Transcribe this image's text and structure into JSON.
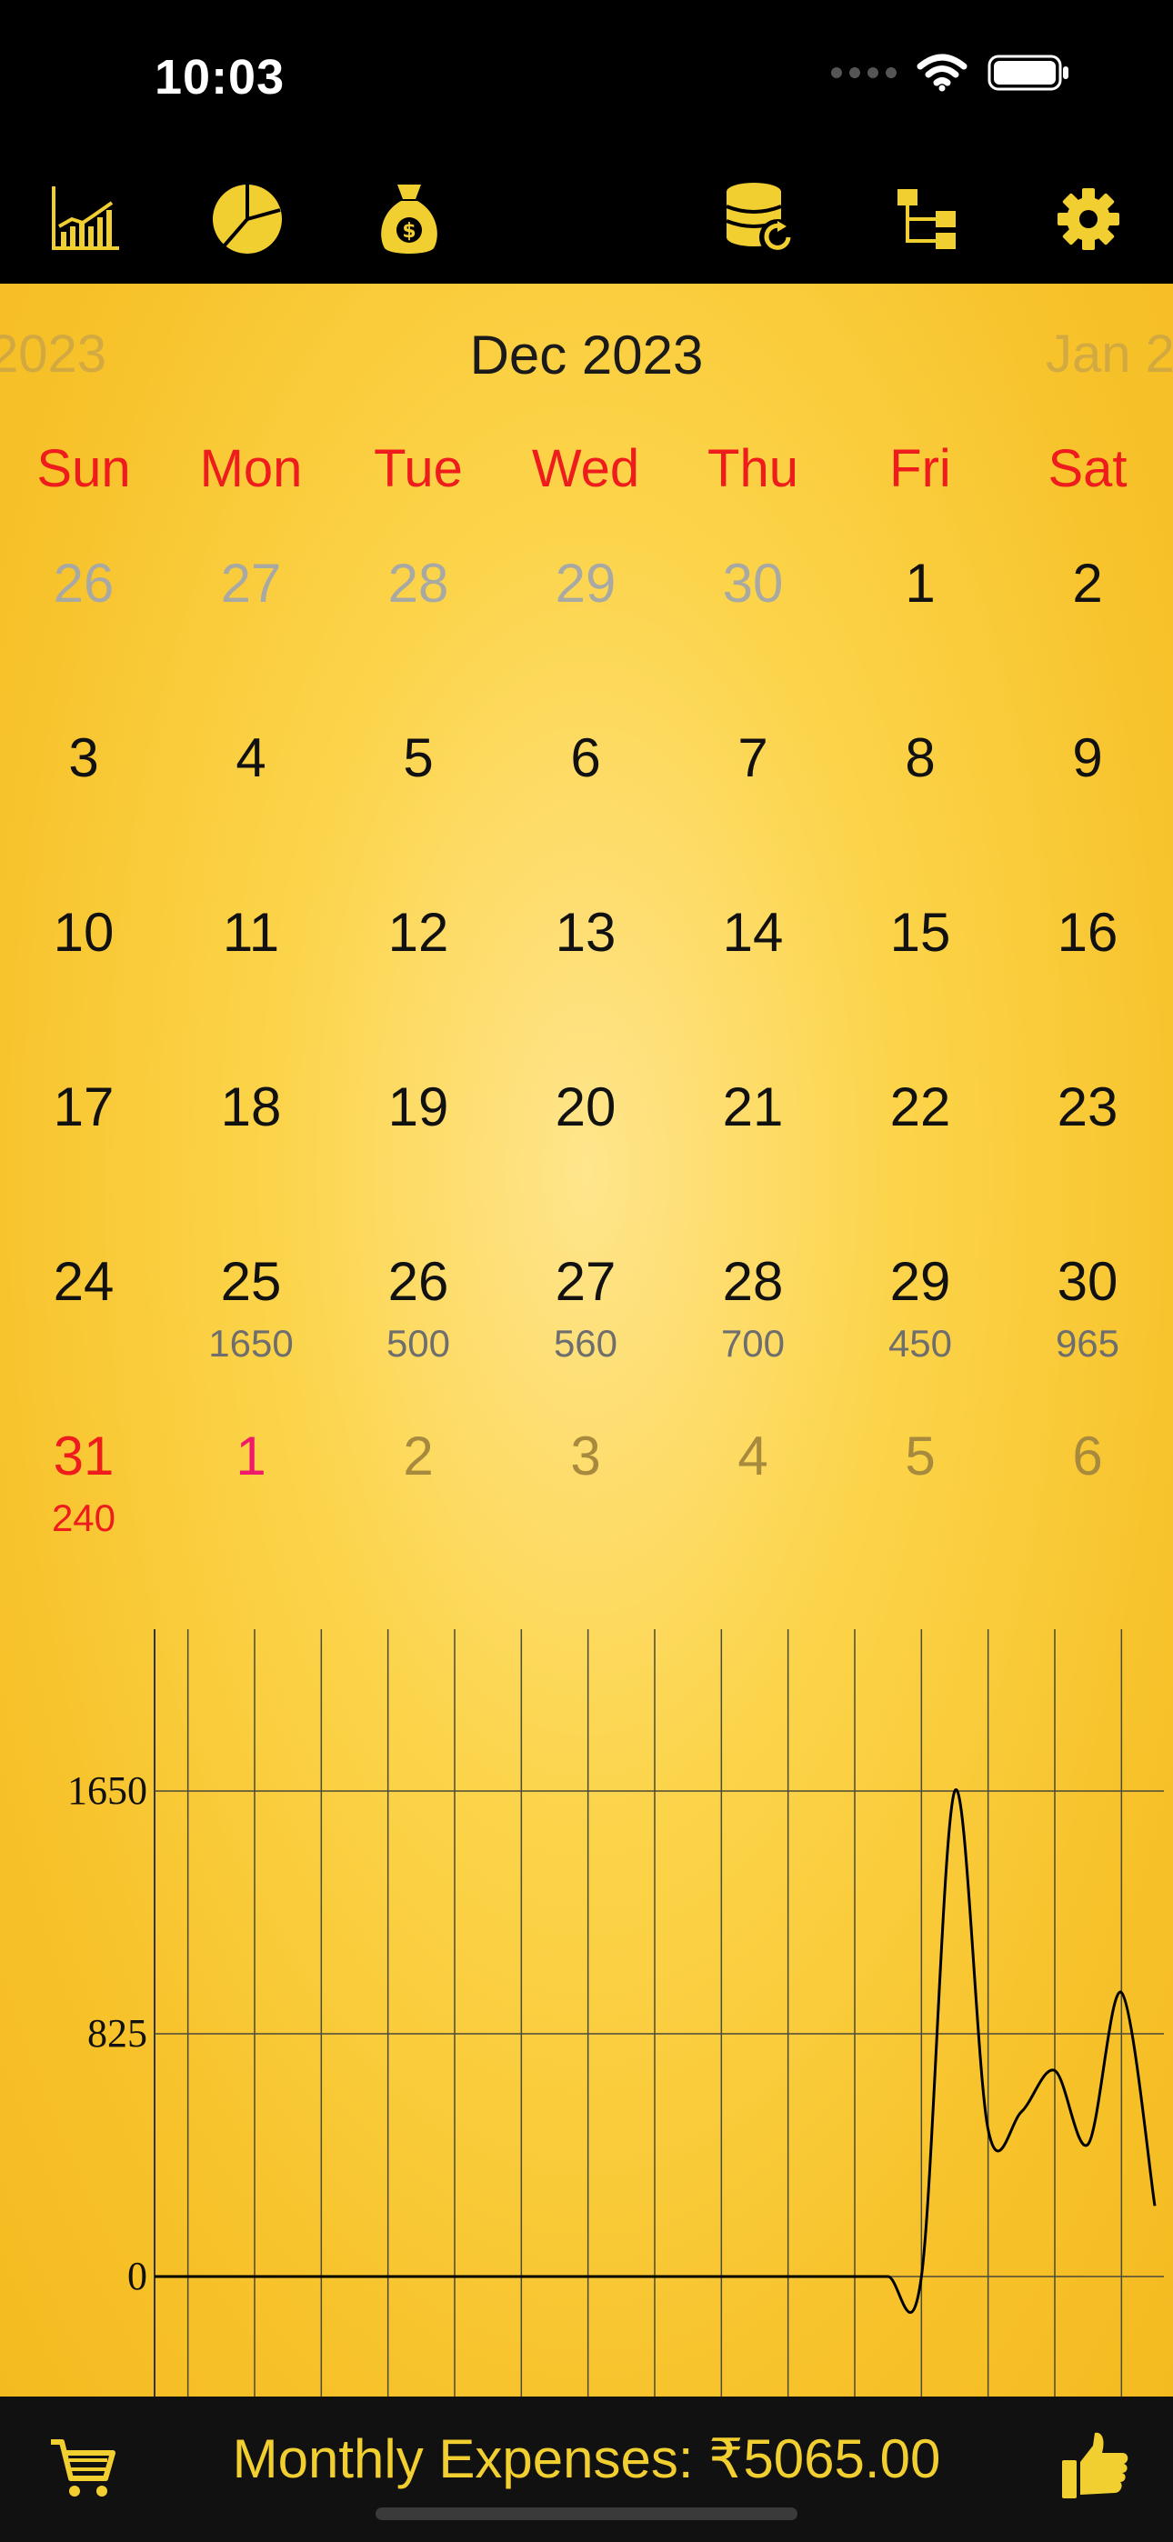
{
  "status_bar": {
    "time": "10:03"
  },
  "toolbar": {
    "items": [
      {
        "icon": "bar-chart-icon"
      },
      {
        "icon": "pie-chart-icon"
      },
      {
        "icon": "money-bag-icon"
      },
      {
        "icon": "coins-refresh-icon"
      },
      {
        "icon": "category-tree-icon"
      },
      {
        "icon": "gear-icon"
      }
    ]
  },
  "month_nav": {
    "prev": "2023",
    "current": "Dec 2023",
    "next": "Jan 2"
  },
  "weekdays": [
    "Sun",
    "Mon",
    "Tue",
    "Wed",
    "Thu",
    "Fri",
    "Sat"
  ],
  "weeks": [
    [
      {
        "day": "26",
        "state": "muted"
      },
      {
        "day": "27",
        "state": "muted"
      },
      {
        "day": "28",
        "state": "muted"
      },
      {
        "day": "29",
        "state": "muted"
      },
      {
        "day": "30",
        "state": "muted"
      },
      {
        "day": "1"
      },
      {
        "day": "2"
      }
    ],
    [
      {
        "day": "3"
      },
      {
        "day": "4"
      },
      {
        "day": "5"
      },
      {
        "day": "6"
      },
      {
        "day": "7"
      },
      {
        "day": "8"
      },
      {
        "day": "9"
      }
    ],
    [
      {
        "day": "10"
      },
      {
        "day": "11"
      },
      {
        "day": "12"
      },
      {
        "day": "13"
      },
      {
        "day": "14"
      },
      {
        "day": "15"
      },
      {
        "day": "16"
      }
    ],
    [
      {
        "day": "17"
      },
      {
        "day": "18"
      },
      {
        "day": "19"
      },
      {
        "day": "20"
      },
      {
        "day": "21"
      },
      {
        "day": "22"
      },
      {
        "day": "23"
      }
    ],
    [
      {
        "day": "24"
      },
      {
        "day": "25",
        "amount": "1650"
      },
      {
        "day": "26",
        "amount": "500"
      },
      {
        "day": "27",
        "amount": "560"
      },
      {
        "day": "28",
        "amount": "700"
      },
      {
        "day": "29",
        "amount": "450"
      },
      {
        "day": "30",
        "amount": "965"
      }
    ],
    [
      {
        "day": "31",
        "amount": "240",
        "state": "today"
      },
      {
        "day": "1",
        "state": "newyear"
      },
      {
        "day": "2",
        "state": "next"
      },
      {
        "day": "3",
        "state": "next"
      },
      {
        "day": "4",
        "state": "next"
      },
      {
        "day": "5",
        "state": "next"
      },
      {
        "day": "6",
        "state": "next"
      }
    ]
  ],
  "chart_data": {
    "type": "line",
    "x": [
      1,
      2,
      3,
      4,
      5,
      6,
      7,
      8,
      9,
      10,
      11,
      12,
      13,
      14,
      15,
      16,
      17,
      18,
      19,
      20,
      21,
      22,
      23,
      24,
      25,
      26,
      27,
      28,
      29,
      30,
      31
    ],
    "values": [
      0,
      0,
      0,
      0,
      0,
      0,
      0,
      0,
      0,
      0,
      0,
      0,
      0,
      0,
      0,
      0,
      0,
      0,
      0,
      0,
      0,
      0,
      0,
      0,
      1650,
      500,
      560,
      700,
      450,
      965,
      240
    ],
    "xticks": [
      "2",
      "4",
      "6",
      "8",
      "10",
      "12",
      "14",
      "16",
      "18",
      "20",
      "22",
      "24",
      "26",
      "28",
      "30"
    ],
    "yticks": [
      "1650",
      "825",
      "0"
    ],
    "xlim": [
      1,
      31
    ],
    "ylim": [
      -550,
      2200
    ],
    "grid": true,
    "line_color": "#000000"
  },
  "bottom_bar": {
    "summary_label": "Monthly Expenses:",
    "summary_value": "₹5065.00",
    "cart_icon": "cart-icon",
    "like_icon": "thumbs-up-icon"
  },
  "colors": {
    "accent_yellow": "#f2cf30",
    "weekday_red": "#ee1c1c",
    "newyear_pink": "#ef1b6a",
    "background_gold": "#f7c22a"
  }
}
